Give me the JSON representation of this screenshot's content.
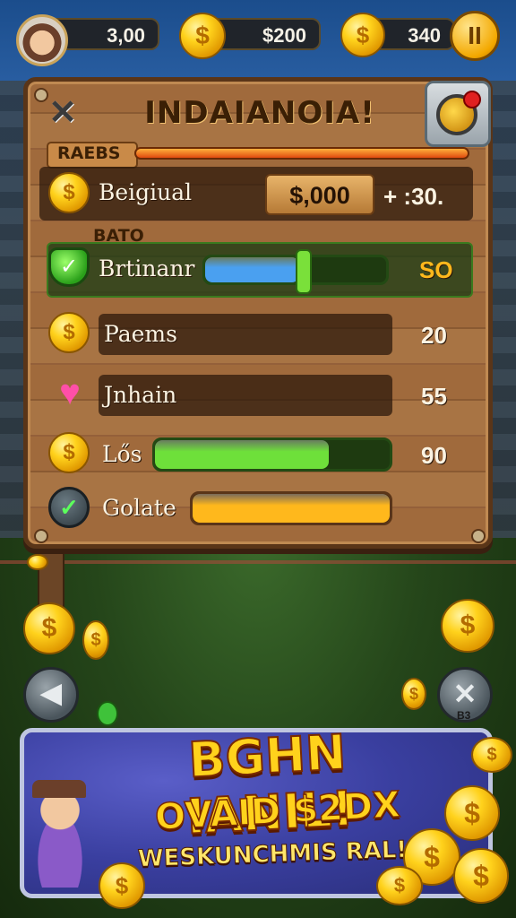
{
  "hud": {
    "player_coins": "3,00",
    "gold": "$200",
    "gems": "340",
    "pause_icon": "pause-icon"
  },
  "board": {
    "title": "INDAIANOIA!",
    "section1_tag": "RAEBS",
    "section2_tag": "BATO",
    "rows": [
      {
        "label": "Beigiual",
        "amount": "$,000",
        "bonus": "+ :30.",
        "icon": "coin-icon"
      },
      {
        "label": "Brtinanr",
        "value": "SO",
        "progress": 0.52,
        "color": "#4aa0f0",
        "icon": "shield-icon"
      },
      {
        "label": "Paems",
        "value": "20",
        "icon": "coin-icon"
      },
      {
        "label": "Jnhain",
        "value": "55",
        "icon": "heart-icon"
      },
      {
        "label": "Lős",
        "value": "90",
        "progress": 0.74,
        "color": "#6ee03a",
        "icon": "coin-icon"
      },
      {
        "label": "Golate",
        "progress": 1.0,
        "color": "#ffb81c",
        "icon": "check-icon"
      }
    ]
  },
  "side_buttons": {
    "corner_label": "B3"
  },
  "banner": {
    "title": "BGHN IANIL!",
    "subtitle": "OVAID $2DX",
    "tagline": "WESKUNCHMIS RAL!!"
  },
  "colors": {
    "gold": "#ffd21c",
    "wood": "#a06a3c",
    "banner": "#3a3fa0"
  }
}
